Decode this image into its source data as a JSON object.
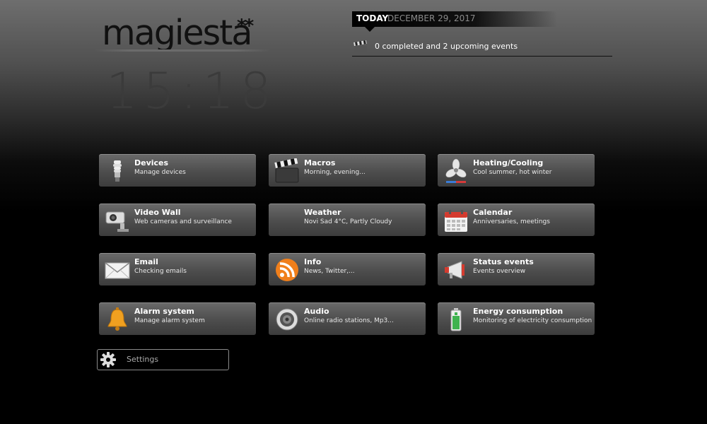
{
  "brand": {
    "name": "magiesta",
    "stars": "**"
  },
  "clock": "15:18",
  "today": {
    "label": "TODAY",
    "date": "DECEMBER 29, 2017",
    "summary": "0 completed and 2 upcoming events"
  },
  "tiles": [
    {
      "title": "Devices",
      "subtitle": "Manage devices",
      "icon": "light-bulb-icon"
    },
    {
      "title": "Macros",
      "subtitle": "Morning, evening...",
      "icon": "clapperboard-icon"
    },
    {
      "title": "Heating/Cooling",
      "subtitle": "Cool summer, hot winter",
      "icon": "fan-icon"
    },
    {
      "title": "Video Wall",
      "subtitle": "Web cameras and surveillance",
      "icon": "security-camera-icon"
    },
    {
      "title": "Weather",
      "subtitle": "Novi Sad 4°C, Partly Cloudy",
      "icon": ""
    },
    {
      "title": "Calendar",
      "subtitle": "Anniversaries, meetings",
      "icon": "calendar-icon"
    },
    {
      "title": "Email",
      "subtitle": "Checking emails",
      "icon": "envelope-icon"
    },
    {
      "title": "Info",
      "subtitle": "News, Twitter,...",
      "icon": "rss-icon"
    },
    {
      "title": "Status events",
      "subtitle": "Events overview",
      "icon": "megaphone-icon"
    },
    {
      "title": "Alarm system",
      "subtitle": "Manage alarm system",
      "icon": "bell-icon"
    },
    {
      "title": "Audio",
      "subtitle": "Online radio stations, Mp3...",
      "icon": "speaker-icon"
    },
    {
      "title": "Energy consumption",
      "subtitle": "Monitoring of electricity consumption",
      "icon": "battery-icon"
    }
  ],
  "settings": {
    "label": "Settings",
    "icon": "gear-icon"
  }
}
